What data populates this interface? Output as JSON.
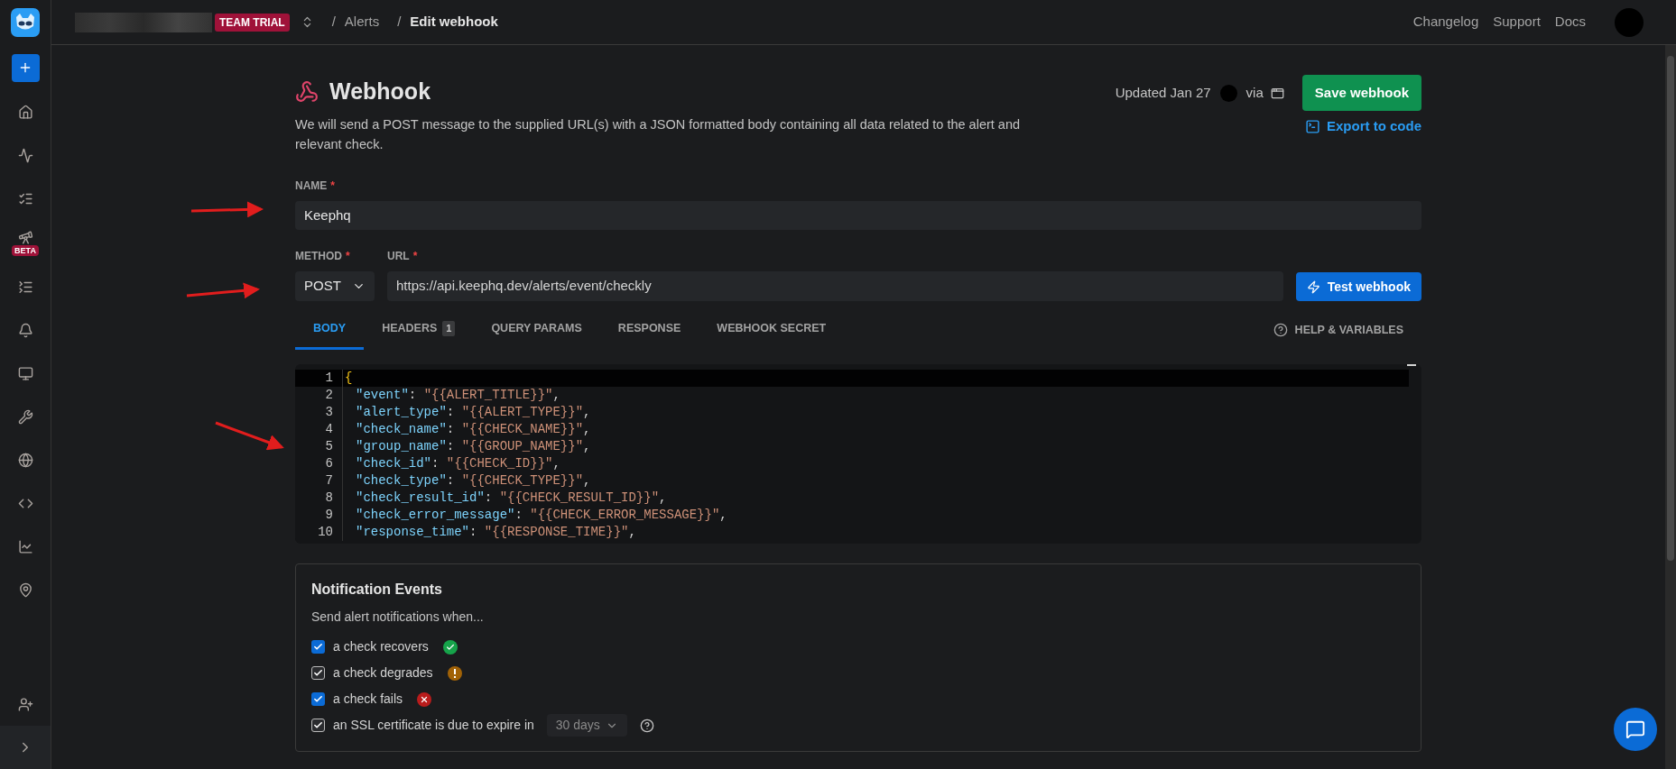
{
  "topbar": {
    "badge": "TEAM TRIAL",
    "breadcrumbs": [
      {
        "separator": "/",
        "label": "Alerts",
        "current": false
      },
      {
        "separator": "/",
        "label": "Edit webhook",
        "current": true
      }
    ],
    "links": [
      "Changelog",
      "Support",
      "Docs"
    ]
  },
  "sidebar": {
    "beta_badge": "BETA"
  },
  "header": {
    "title": "Webhook",
    "description": "We will send a POST message to the supplied URL(s) with a JSON formatted body containing all data related to the alert and relevant check.",
    "updated": "Updated Jan 27",
    "via": "via",
    "save_button": "Save webhook",
    "export_link": "Export to code"
  },
  "name_field": {
    "label": "NAME",
    "required_mark": "*",
    "value": "Keephq"
  },
  "method_field": {
    "label": "METHOD",
    "required_mark": "*",
    "value": "POST"
  },
  "url_field": {
    "label": "URL",
    "required_mark": "*",
    "value": "https://api.keephq.dev/alerts/event/checkly"
  },
  "test_button": "Test webhook",
  "tabs": [
    {
      "label": "BODY",
      "selected": true
    },
    {
      "label": "HEADERS",
      "count": "1",
      "selected": false
    },
    {
      "label": "QUERY PARAMS",
      "selected": false
    },
    {
      "label": "RESPONSE",
      "selected": false
    },
    {
      "label": "WEBHOOK SECRET",
      "selected": false
    }
  ],
  "help_link": "HELP & VARIABLES",
  "code_lines": [
    {
      "number": "1",
      "current": true,
      "tokens": [
        {
          "kind": "brace",
          "text": "{"
        }
      ]
    },
    {
      "number": "2",
      "current": false,
      "tokens": [
        {
          "kind": "key",
          "text": "\"event\""
        },
        {
          "kind": "punct",
          "text": ": "
        },
        {
          "kind": "string",
          "text": "\"{{ALERT_TITLE}}\""
        },
        {
          "kind": "punct",
          "text": ","
        }
      ]
    },
    {
      "number": "3",
      "current": false,
      "tokens": [
        {
          "kind": "key",
          "text": "\"alert_type\""
        },
        {
          "kind": "punct",
          "text": ": "
        },
        {
          "kind": "string",
          "text": "\"{{ALERT_TYPE}}\""
        },
        {
          "kind": "punct",
          "text": ","
        }
      ]
    },
    {
      "number": "4",
      "current": false,
      "tokens": [
        {
          "kind": "key",
          "text": "\"check_name\""
        },
        {
          "kind": "punct",
          "text": ": "
        },
        {
          "kind": "string",
          "text": "\"{{CHECK_NAME}}\""
        },
        {
          "kind": "punct",
          "text": ","
        }
      ]
    },
    {
      "number": "5",
      "current": false,
      "tokens": [
        {
          "kind": "key",
          "text": "\"group_name\""
        },
        {
          "kind": "punct",
          "text": ": "
        },
        {
          "kind": "string",
          "text": "\"{{GROUP_NAME}}\""
        },
        {
          "kind": "punct",
          "text": ","
        }
      ]
    },
    {
      "number": "6",
      "current": false,
      "tokens": [
        {
          "kind": "key",
          "text": "\"check_id\""
        },
        {
          "kind": "punct",
          "text": ": "
        },
        {
          "kind": "string",
          "text": "\"{{CHECK_ID}}\""
        },
        {
          "kind": "punct",
          "text": ","
        }
      ]
    },
    {
      "number": "7",
      "current": false,
      "tokens": [
        {
          "kind": "key",
          "text": "\"check_type\""
        },
        {
          "kind": "punct",
          "text": ": "
        },
        {
          "kind": "string",
          "text": "\"{{CHECK_TYPE}}\""
        },
        {
          "kind": "punct",
          "text": ","
        }
      ]
    },
    {
      "number": "8",
      "current": false,
      "tokens": [
        {
          "kind": "key",
          "text": "\"check_result_id\""
        },
        {
          "kind": "punct",
          "text": ": "
        },
        {
          "kind": "string",
          "text": "\"{{CHECK_RESULT_ID}}\""
        },
        {
          "kind": "punct",
          "text": ","
        }
      ]
    },
    {
      "number": "9",
      "current": false,
      "tokens": [
        {
          "kind": "key",
          "text": "\"check_error_message\""
        },
        {
          "kind": "punct",
          "text": ": "
        },
        {
          "kind": "string",
          "text": "\"{{CHECK_ERROR_MESSAGE}}\""
        },
        {
          "kind": "punct",
          "text": ","
        }
      ]
    },
    {
      "number": "10",
      "current": false,
      "tokens": [
        {
          "kind": "key",
          "text": "\"response_time\""
        },
        {
          "kind": "punct",
          "text": ": "
        },
        {
          "kind": "string",
          "text": "\"{{RESPONSE_TIME}}\""
        },
        {
          "kind": "punct",
          "text": ","
        }
      ]
    }
  ],
  "notifications": {
    "title": "Notification Events",
    "subtitle": "Send alert notifications when...",
    "events": [
      {
        "label": "a check recovers",
        "checked": true,
        "kind": "accent"
      },
      {
        "label": "a check degrades",
        "checked": true,
        "kind": "plain"
      },
      {
        "label": "a check fails",
        "checked": true,
        "kind": "accent"
      },
      {
        "label": "an SSL certificate is due to expire in",
        "checked": true,
        "kind": "plain",
        "select": "30 days"
      }
    ]
  }
}
